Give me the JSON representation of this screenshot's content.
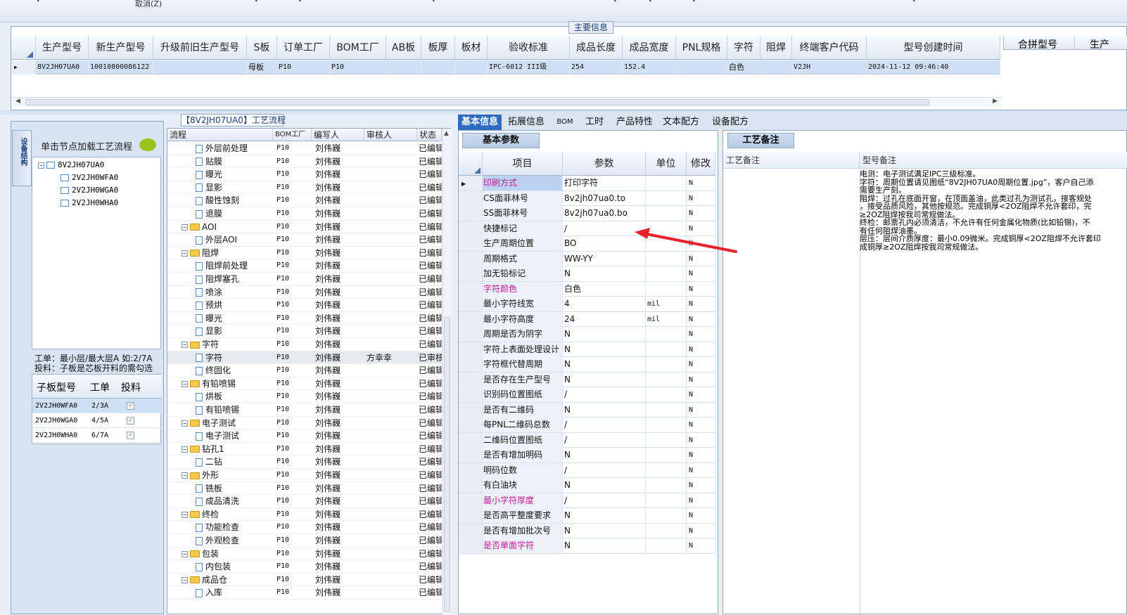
{
  "topbar": {
    "cancel_label": "取消(Z)"
  },
  "main_info": {
    "title": "主要信息",
    "columns": [
      "生产型号",
      "新生产型号",
      "升级前旧生产型号",
      "S板",
      "订单工厂",
      "BOM工厂",
      "AB板",
      "板厚",
      "板材",
      "验收标准",
      "成品长度",
      "成品宽度",
      "PNL规格",
      "字符",
      "阻焊",
      "终端客户代码",
      "型号创建时间"
    ],
    "row": {
      "生产型号": "8V2JH07UA0",
      "新生产型号": "10010800086122",
      "S板": "母板",
      "订单工厂": "P10",
      "BOM工厂": "P10",
      "验收标准": "IPC-6012 III级",
      "成品长度": "254",
      "成品宽度": "152.4",
      "字符": "白色",
      "终端客户代码": "V2JH",
      "型号创建时间": "2024-11-12 09:46:40"
    },
    "right_columns": [
      "合拼型号",
      "生产"
    ]
  },
  "left": {
    "vtab_label": "设备结构",
    "load_hint": "单击节点加载工艺流程",
    "tree": {
      "root": "8V2JH07UA0",
      "children": [
        "2V2JH0WFA0",
        "2V2JH0WGA0",
        "2V2JH0WHA0"
      ]
    },
    "note_line1": "工单：最小层/最大层A 如:2/7A",
    "note_line2": "投料：子板是芯板开料的需勾选",
    "sub_columns": [
      "子板型号",
      "工单",
      "投料"
    ],
    "sub_rows": [
      {
        "model": "2V2JH0WFA0",
        "order": "2/3A"
      },
      {
        "model": "2V2JH0WGA0",
        "order": "4/5A"
      },
      {
        "model": "2V2JH0WHA0",
        "order": "6/7A"
      }
    ]
  },
  "flow": {
    "title": "【8V2JH07UA0】工艺流程",
    "columns": [
      "流程",
      "BOM工厂",
      "编写人",
      "审核人",
      "状态"
    ],
    "rows": [
      {
        "name": "外层前处理",
        "folder": false,
        "bom": "P10",
        "writer": "刘伟巍",
        "reviewer": "",
        "status": "已编辑"
      },
      {
        "name": "贴膜",
        "folder": false,
        "bom": "P10",
        "writer": "刘伟巍",
        "reviewer": "",
        "status": "已编辑"
      },
      {
        "name": "曝光",
        "folder": false,
        "bom": "P10",
        "writer": "刘伟巍",
        "reviewer": "",
        "status": "已编辑"
      },
      {
        "name": "显影",
        "folder": false,
        "bom": "P10",
        "writer": "刘伟巍",
        "reviewer": "",
        "status": "已编辑"
      },
      {
        "name": "酸性蚀刻",
        "folder": false,
        "bom": "P10",
        "writer": "刘伟巍",
        "reviewer": "",
        "status": "已编辑"
      },
      {
        "name": "退膜",
        "folder": false,
        "bom": "P10",
        "writer": "刘伟巍",
        "reviewer": "",
        "status": "已编辑"
      },
      {
        "name": "AOI",
        "folder": true,
        "bom": "P10",
        "writer": "刘伟巍",
        "reviewer": "",
        "status": "已编辑"
      },
      {
        "name": "外层AOI",
        "folder": false,
        "bom": "P10",
        "writer": "刘伟巍",
        "reviewer": "",
        "status": "已编辑"
      },
      {
        "name": "阻焊",
        "folder": true,
        "bom": "P10",
        "writer": "刘伟巍",
        "reviewer": "",
        "status": "已编辑"
      },
      {
        "name": "阻焊前处理",
        "folder": false,
        "bom": "P10",
        "writer": "刘伟巍",
        "reviewer": "",
        "status": "已编辑"
      },
      {
        "name": "阻焊塞孔",
        "folder": false,
        "bom": "P10",
        "writer": "刘伟巍",
        "reviewer": "",
        "status": "已编辑"
      },
      {
        "name": "喷涂",
        "folder": false,
        "bom": "P10",
        "writer": "刘伟巍",
        "reviewer": "",
        "status": "已编辑"
      },
      {
        "name": "预烘",
        "folder": false,
        "bom": "P10",
        "writer": "刘伟巍",
        "reviewer": "",
        "status": "已编辑"
      },
      {
        "name": "曝光",
        "folder": false,
        "bom": "P10",
        "writer": "刘伟巍",
        "reviewer": "",
        "status": "已编辑"
      },
      {
        "name": "显影",
        "folder": false,
        "bom": "P10",
        "writer": "刘伟巍",
        "reviewer": "",
        "status": "已编辑"
      },
      {
        "name": "字符",
        "folder": true,
        "bom": "P10",
        "writer": "刘伟巍",
        "reviewer": "",
        "status": "已编辑"
      },
      {
        "name": "字符",
        "folder": false,
        "bom": "P10",
        "writer": "刘伟巍",
        "reviewer": "方幸幸",
        "status": "已审核",
        "selected": true
      },
      {
        "name": "终固化",
        "folder": false,
        "bom": "P10",
        "writer": "刘伟巍",
        "reviewer": "",
        "status": "已编辑"
      },
      {
        "name": "有铅喷锡",
        "folder": true,
        "bom": "P10",
        "writer": "刘伟巍",
        "reviewer": "",
        "status": "已编辑"
      },
      {
        "name": "烘板",
        "folder": false,
        "bom": "P10",
        "writer": "刘伟巍",
        "reviewer": "",
        "status": "已编辑"
      },
      {
        "name": "有铅喷锡",
        "folder": false,
        "bom": "P10",
        "writer": "刘伟巍",
        "reviewer": "",
        "status": "已编辑"
      },
      {
        "name": "电子测试",
        "folder": true,
        "bom": "P10",
        "writer": "刘伟巍",
        "reviewer": "",
        "status": "已编辑"
      },
      {
        "name": "电子测试",
        "folder": false,
        "bom": "P10",
        "writer": "刘伟巍",
        "reviewer": "",
        "status": "已编辑"
      },
      {
        "name": "钻孔1",
        "folder": true,
        "bom": "P10",
        "writer": "刘伟巍",
        "reviewer": "",
        "status": "已编辑"
      },
      {
        "name": "二钻",
        "folder": false,
        "bom": "P10",
        "writer": "刘伟巍",
        "reviewer": "",
        "status": "已编辑"
      },
      {
        "name": "外形",
        "folder": true,
        "bom": "P10",
        "writer": "刘伟巍",
        "reviewer": "",
        "status": "已编辑"
      },
      {
        "name": "铣板",
        "folder": false,
        "bom": "P10",
        "writer": "刘伟巍",
        "reviewer": "",
        "status": "已编辑"
      },
      {
        "name": "成品清洗",
        "folder": false,
        "bom": "P10",
        "writer": "刘伟巍",
        "reviewer": "",
        "status": "已编辑"
      },
      {
        "name": "终检",
        "folder": true,
        "bom": "P10",
        "writer": "刘伟巍",
        "reviewer": "",
        "status": "已编辑"
      },
      {
        "name": "功能检查",
        "folder": false,
        "bom": "P10",
        "writer": "刘伟巍",
        "reviewer": "",
        "status": "已编辑"
      },
      {
        "name": "外观检查",
        "folder": false,
        "bom": "P10",
        "writer": "刘伟巍",
        "reviewer": "",
        "status": "已编辑"
      },
      {
        "name": "包装",
        "folder": true,
        "bom": "P10",
        "writer": "刘伟巍",
        "reviewer": "",
        "status": "已编辑"
      },
      {
        "name": "内包装",
        "folder": false,
        "bom": "P10",
        "writer": "刘伟巍",
        "reviewer": "",
        "status": "已编辑"
      },
      {
        "name": "成品仓",
        "folder": true,
        "bom": "P10",
        "writer": "刘伟巍",
        "reviewer": "",
        "status": "已编辑"
      },
      {
        "name": "入库",
        "folder": false,
        "bom": "P10",
        "writer": "刘伟巍",
        "reviewer": "",
        "status": "已编辑"
      }
    ]
  },
  "tabs": [
    "基本信息",
    "拓展信息",
    "BOM",
    "工时",
    "产品特性",
    "文本配方",
    "设备配方"
  ],
  "basic": {
    "subtab": "基本参数",
    "columns": [
      "项目",
      "参数",
      "单位",
      "修改"
    ],
    "rows": [
      {
        "item": "印刷方式",
        "param": "打印字符",
        "unit": "",
        "mod": "N",
        "pink": true,
        "current": true
      },
      {
        "item": "CS面菲林号",
        "param": "8v2jh07ua0.to",
        "unit": "",
        "mod": "N"
      },
      {
        "item": "SS面菲林号",
        "param": "8v2jh07ua0.bo",
        "unit": "",
        "mod": "N"
      },
      {
        "item": "快捷标记",
        "param": "/",
        "unit": "",
        "mod": "N"
      },
      {
        "item": "生产周期位置",
        "param": "BO",
        "unit": "",
        "mod": "N"
      },
      {
        "item": "周期格式",
        "param": "WW-YY",
        "unit": "",
        "mod": "N"
      },
      {
        "item": "加无铅标记",
        "param": "N",
        "unit": "",
        "mod": "N"
      },
      {
        "item": "字符颜色",
        "param": "白色",
        "unit": "",
        "mod": "N",
        "pink": true
      },
      {
        "item": "最小字符线宽",
        "param": "4",
        "unit": "mil",
        "mod": "N"
      },
      {
        "item": "最小字符高度",
        "param": "24",
        "unit": "mil",
        "mod": "N"
      },
      {
        "item": "周期是否为阴字",
        "param": "N",
        "unit": "",
        "mod": "N"
      },
      {
        "item": "字符上表面处理设计",
        "param": "N",
        "unit": "",
        "mod": "N"
      },
      {
        "item": "字符框代替周期",
        "param": "N",
        "unit": "",
        "mod": "N"
      },
      {
        "item": "是否存在生产型号",
        "param": "N",
        "unit": "",
        "mod": "N"
      },
      {
        "item": "识别码位置图纸",
        "param": "/",
        "unit": "",
        "mod": "N"
      },
      {
        "item": "是否有二维码",
        "param": "N",
        "unit": "",
        "mod": "N"
      },
      {
        "item": "每PNL二维码总数",
        "param": "/",
        "unit": "",
        "mod": "N"
      },
      {
        "item": "二维码位置图纸",
        "param": "/",
        "unit": "",
        "mod": "N"
      },
      {
        "item": "是否有增加明码",
        "param": "N",
        "unit": "",
        "mod": "N"
      },
      {
        "item": "明码位数",
        "param": "/",
        "unit": "",
        "mod": "N"
      },
      {
        "item": "有白油块",
        "param": "N",
        "unit": "",
        "mod": "N"
      },
      {
        "item": "最小字符厚度",
        "param": "/",
        "unit": "",
        "mod": "N",
        "pink": true
      },
      {
        "item": "是否高平整度要求",
        "param": "N",
        "unit": "",
        "mod": "N"
      },
      {
        "item": "是否有增加批次号",
        "param": "N",
        "unit": "",
        "mod": "N"
      },
      {
        "item": "是否单面字符",
        "param": "N",
        "unit": "",
        "mod": "N",
        "pink": true
      }
    ]
  },
  "notes": {
    "tab": "工艺备注",
    "col1": "工艺备注",
    "col2": "型号备注",
    "lines": [
      "电测：电子测试满足IPC三级标准。",
      "字符：周期位置请见图纸“8V2JH07UA0周期位置.jpg”，客户自己添",
      "需要生产刻。",
      "阻焊：过孔在底面开窗，在顶面盖油，此类过孔为测试孔，接客规处",
      "，接受品质风险，其他按规范。完成铜厚<2OZ阻焊不允许套印，完",
      "≥2OZ阻焊按我司常规做法。",
      "终检：邮票孔内必须清洁，不允许有任何金属化物质(比如铅锡)，不",
      "有任何阻焊油墨。",
      "层压：层间介质厚度：最小0.09微米。完成铜厚<2OZ阻焊不允许套印",
      "成铜厚≥2OZ阻焊按我司常规做法。"
    ]
  },
  "colors": {
    "accent": "#2c6bbf",
    "selected_row": "#cfe0f5",
    "pink_label": "#c2189a",
    "annotation_arrow": "#e8222a"
  }
}
